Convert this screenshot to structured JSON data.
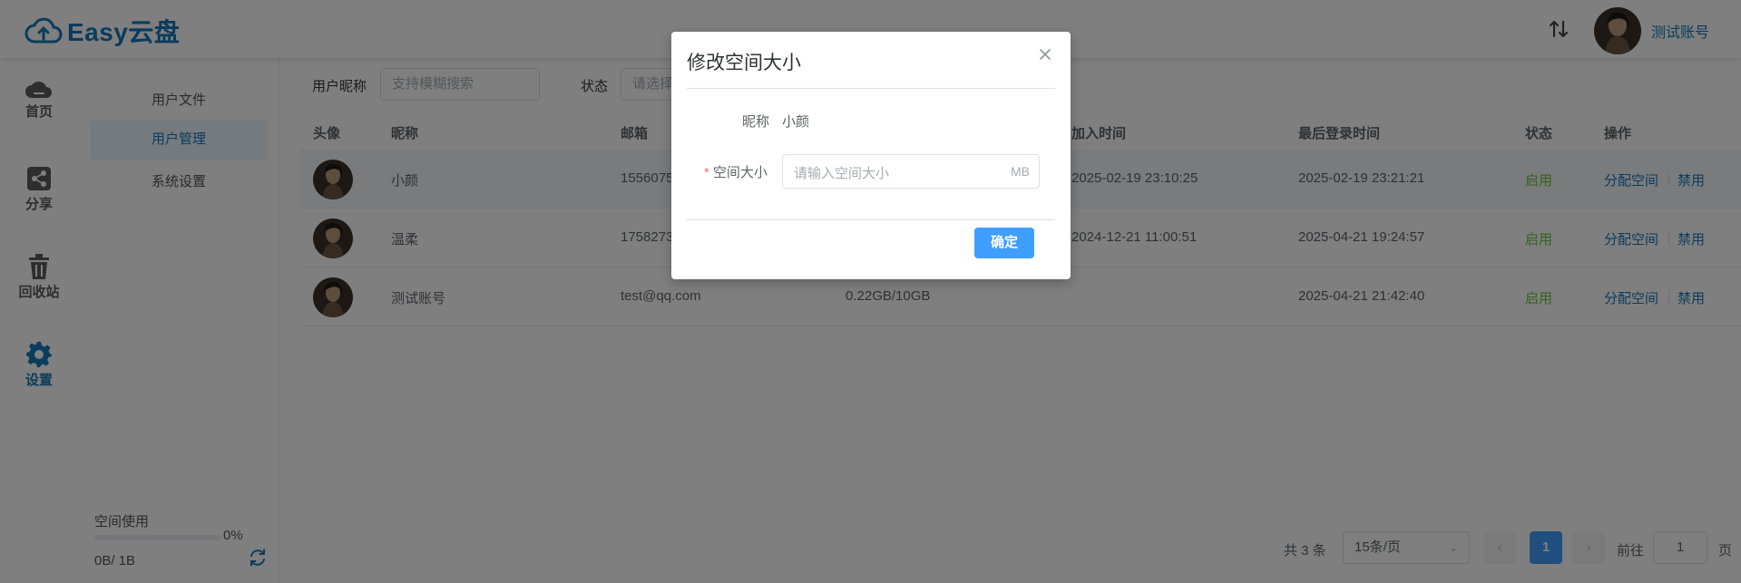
{
  "app": {
    "logo_text": "Easy云盘",
    "brand_color": "#1479b8",
    "user_name": "测试账号"
  },
  "leftnav": {
    "items": [
      {
        "label": "首页",
        "icon": "cloud-icon"
      },
      {
        "label": "分享",
        "icon": "share-icon"
      },
      {
        "label": "回收站",
        "icon": "trash-icon"
      },
      {
        "label": "设置",
        "icon": "gear-icon",
        "active": true
      }
    ]
  },
  "subnav": {
    "items": [
      {
        "label": "用户文件"
      },
      {
        "label": "用户管理",
        "active": true
      },
      {
        "label": "系统设置"
      }
    ],
    "space_title": "空间使用",
    "space_percent": "0%",
    "space_used": "0B/ 1B"
  },
  "filters": {
    "nickname_label": "用户昵称",
    "nickname_placeholder": "支持模糊搜索",
    "status_label": "状态",
    "status_placeholder": "请选择"
  },
  "table": {
    "headers": {
      "avatar": "头像",
      "nickname": "昵称",
      "email": "邮箱",
      "join_time": "加入时间",
      "last_login": "最后登录时间",
      "status": "状态",
      "ops": "操作"
    },
    "rows": [
      {
        "nickname": "小颜",
        "email": "1556075",
        "space": "",
        "join_time": "2025-02-19 23:10:25",
        "last_login": "2025-02-19 23:21:21",
        "status": "启用",
        "op_assign": "分配空间",
        "op_disable": "禁用"
      },
      {
        "nickname": "温柔",
        "email": "1758273",
        "space": "",
        "join_time": "2024-12-21 11:00:51",
        "last_login": "2025-04-21 19:24:57",
        "status": "启用",
        "op_assign": "分配空间",
        "op_disable": "禁用"
      },
      {
        "nickname": "测试账号",
        "email": "test@qq.com",
        "space": "0.22GB/10GB",
        "join_time": "",
        "last_login": "2025-04-21 21:42:40",
        "status": "启用",
        "op_assign": "分配空间",
        "op_disable": "禁用"
      }
    ]
  },
  "pager": {
    "total": "共 3 条",
    "page_size": "15条/页",
    "current_page": "1",
    "goto_label": "前往",
    "goto_value": "1",
    "page_unit": "页"
  },
  "dialog": {
    "title": "修改空间大小",
    "nickname_label": "昵称",
    "nickname_value": "小颜",
    "space_label": "空间大小",
    "space_placeholder": "请输入空间大小",
    "space_suffix": "MB",
    "confirm_label": "确定"
  }
}
